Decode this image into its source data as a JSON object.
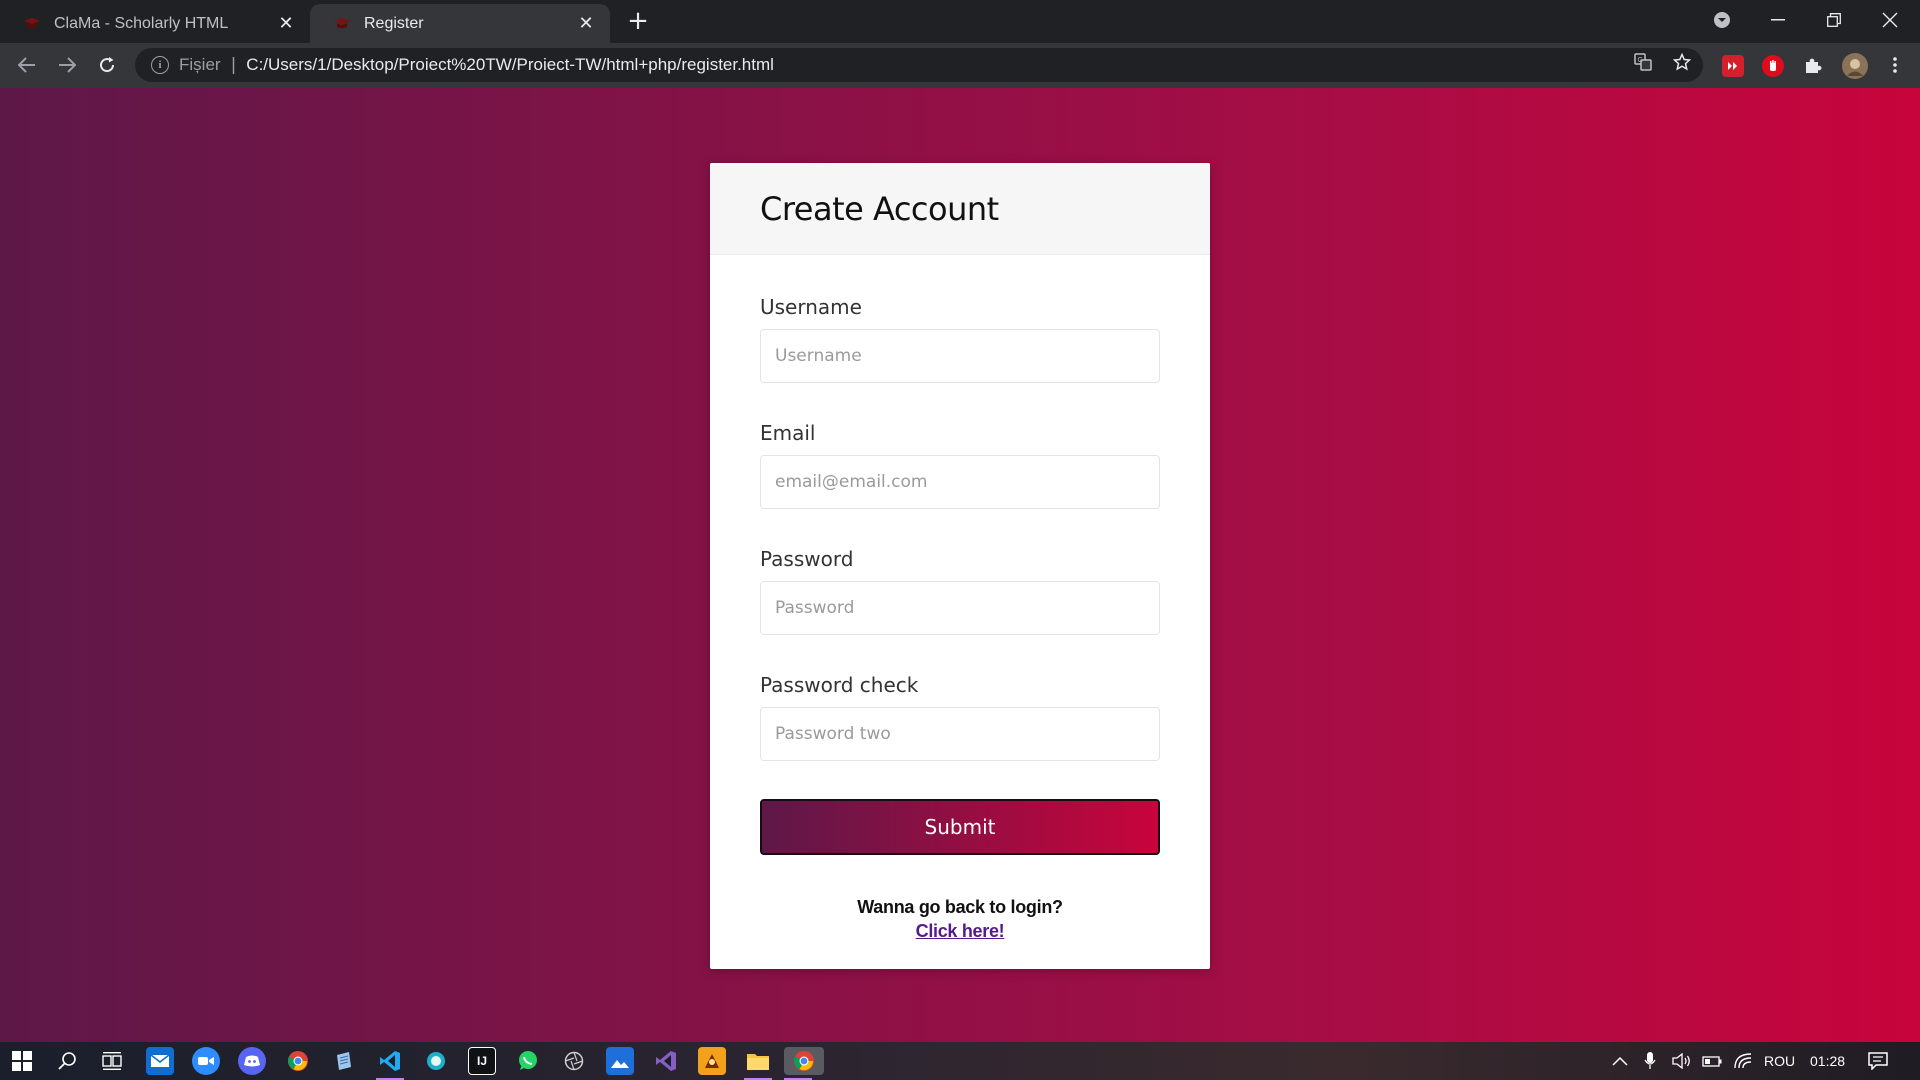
{
  "browser": {
    "tabs": [
      {
        "title": "ClaMa - Scholarly HTML",
        "active": false
      },
      {
        "title": "Register",
        "active": true
      }
    ],
    "new_tab_icon": "plus-icon",
    "scheme_label": "Fișier",
    "url": "C:/Users/1/Desktop/Proiect%20TW/Proiect-TW/html+php/register.html"
  },
  "form": {
    "title": "Create Account",
    "fields": [
      {
        "label": "Username",
        "placeholder": "Username",
        "value": ""
      },
      {
        "label": "Email",
        "placeholder": "email@email.com",
        "value": ""
      },
      {
        "label": "Password",
        "placeholder": "Password",
        "value": ""
      },
      {
        "label": "Password check",
        "placeholder": "Password two",
        "value": ""
      }
    ],
    "submit_label": "Submit",
    "back_prompt": "Wanna go back to login?",
    "back_link": "Click here!"
  },
  "taskbar": {
    "language": "ROU",
    "time": "01:28"
  },
  "colors": {
    "gradient_start": "#5d1848",
    "gradient_end": "#c8043c",
    "link": "#551a8b"
  }
}
